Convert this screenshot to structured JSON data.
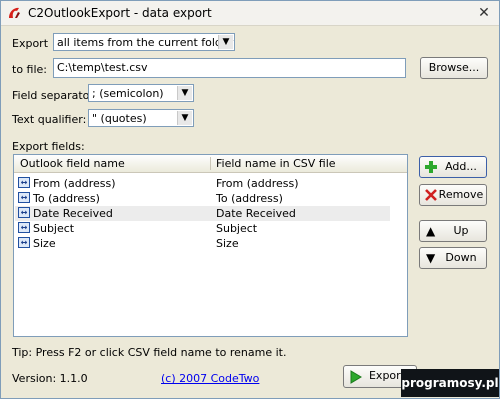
{
  "window": {
    "title": "C2OutlookExport - data export",
    "close_glyph": "✕"
  },
  "form": {
    "export_label": "Export",
    "export_value": "all items from the current folder",
    "to_file_label": "to file:",
    "to_file_value": "C:\\temp\\test.csv",
    "browse_label": "Browse...",
    "field_sep_label": "Field separator:",
    "field_sep_value": "; (semicolon)",
    "text_qual_label": "Text qualifier:",
    "text_qual_value": "\" (quotes)",
    "export_fields_label": "Export fields:"
  },
  "list": {
    "col1": "Outlook field name",
    "col2": "Field name in CSV file",
    "rows": [
      {
        "outlook": "From (address)",
        "csv": "From (address)"
      },
      {
        "outlook": "To (address)",
        "csv": "To (address)"
      },
      {
        "outlook": "Date Received",
        "csv": "Date Received"
      },
      {
        "outlook": "Subject",
        "csv": "Subject"
      },
      {
        "outlook": "Size",
        "csv": "Size"
      }
    ],
    "selected_row": 2
  },
  "buttons": {
    "add": "Add...",
    "remove": "Remove",
    "up": "Up",
    "down": "Down",
    "export": "Export"
  },
  "footer": {
    "tip": "Tip: Press F2 or click CSV field name to rename it.",
    "version": "Version: 1.1.0",
    "copyright": "(c) 2007 CodeTwo"
  },
  "watermark": "programosy.pl",
  "colors": {
    "accent_border": "#7f9db9",
    "selected_row": "#ececec",
    "link": "#0000ee"
  },
  "icons": {
    "app": "app-logo-icon",
    "add": "green-plus-icon",
    "remove": "red-x-icon",
    "up": "arrow-up-icon",
    "down": "arrow-down-icon",
    "export": "green-play-icon",
    "field_row": "field-mapping-icon"
  }
}
